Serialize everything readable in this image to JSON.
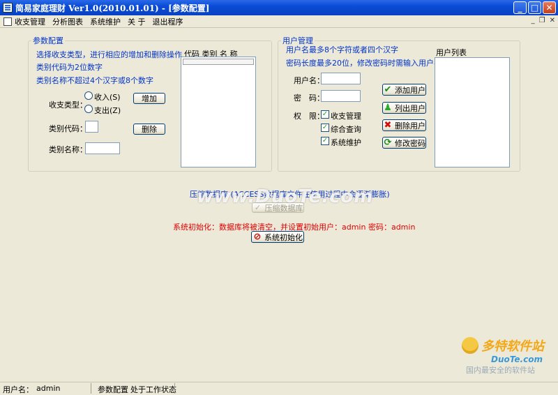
{
  "window": {
    "title": "简易家庭理财 Ver1.0(2010.01.01) - [参数配置]"
  },
  "menu": {
    "items": [
      "收支管理",
      "分析图表",
      "系统维护",
      "关 于",
      "退出程序"
    ]
  },
  "params": {
    "legend": "参数配置",
    "hint1": "选择收支类型，进行相应的增加和删除操作",
    "hint2": "类别代码为2位数字",
    "hint3": "类别名称不超过4个汉字或8个数字",
    "type_label": "收支类型：",
    "radio_income": "收入(S)",
    "radio_expense": "支出(Z)",
    "code_label": "类别代码：",
    "name_label": "类别名称：",
    "add_button": "增加",
    "delete_button": "删除",
    "list_header": "代码 类别 名 称",
    "code_value": "",
    "name_value": ""
  },
  "users": {
    "legend": "用户管理",
    "hint1": "用户名最多8个字符或者四个汉字",
    "hint2": "密码长度最多20位，修改密码时需输入用户名",
    "username_label": "用户名：",
    "password_label": "密　码：",
    "rights_label": "权　限：",
    "rights": [
      {
        "label": "收支管理",
        "checked": true
      },
      {
        "label": "综合查询",
        "checked": true
      },
      {
        "label": "系统维护",
        "checked": true
      }
    ],
    "list_label": "用户列表",
    "add_user": "添加用户",
    "list_users": "列出用户",
    "delete_user": "删除用户",
    "change_password": "修改密码",
    "username_value": "",
    "password_value": ""
  },
  "compact": {
    "text": "压缩数据库 (ACCESS数据库文件在使用过程中会逐渐膨胀)",
    "button": "压缩数据库"
  },
  "init": {
    "text": "系统初始化：数据库将被清空，并设置初始用户：admin 密码：admin",
    "button": "系统初始化"
  },
  "status": {
    "user_label": "用户名：",
    "user_value": "admin",
    "page": "参数配置",
    "state": "处于工作状态"
  },
  "watermarks": {
    "center": "www.DuoTe.com",
    "logo_cn": "多特软件站",
    "logo_en": "DuoTe.com",
    "logo_sub": "国内最安全的软件站"
  },
  "colors": {
    "title_bar": "#0a4bd6",
    "hint_blue": "#0033cc",
    "warn_red": "#e00000",
    "background": "#ece9d8"
  }
}
